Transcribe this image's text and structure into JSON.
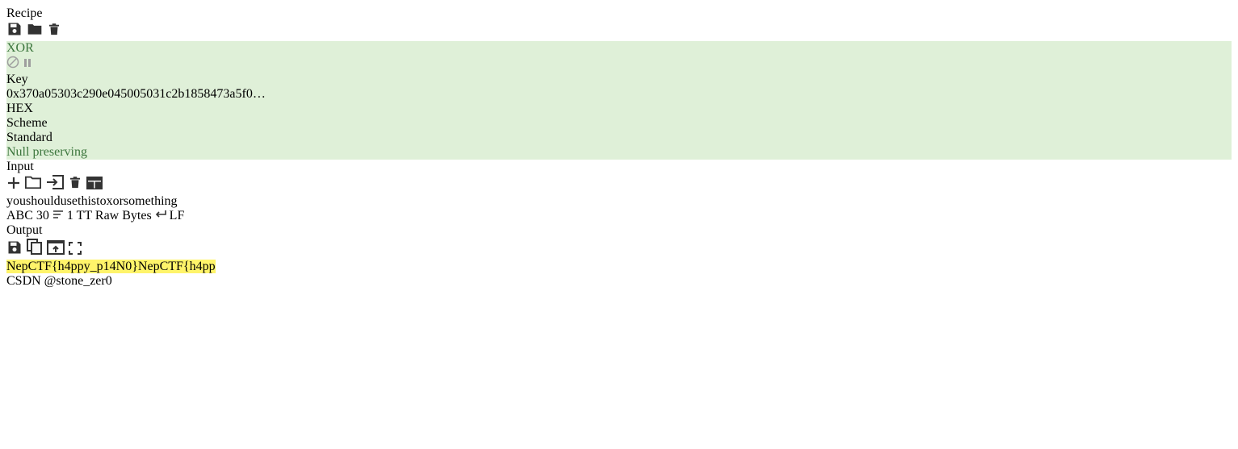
{
  "recipe": {
    "title": "Recipe",
    "operation": {
      "name": "XOR",
      "key_label": "Key",
      "key_value": "0x370a05303c290e045005031c2b1858473a5f0…",
      "key_format": "HEX",
      "scheme_label": "Scheme",
      "scheme_value": "Standard",
      "null_preserving_label": "Null preserving",
      "null_preserving_checked": false
    }
  },
  "input": {
    "title": "Input",
    "text": "youshouldusethistoxorsomething",
    "status": {
      "char_count": "30",
      "line_count": "1",
      "encoding": "Raw Bytes",
      "eol": "LF"
    }
  },
  "output": {
    "title": "Output",
    "text": "NepCTF{h4ppy_p14N0}NepCTF{h4pp"
  },
  "watermark": "CSDN @stone_zer0",
  "colors": {
    "op_bg": "#dff0d8",
    "op_text": "#3c763d",
    "highlight": "#fff46a"
  }
}
